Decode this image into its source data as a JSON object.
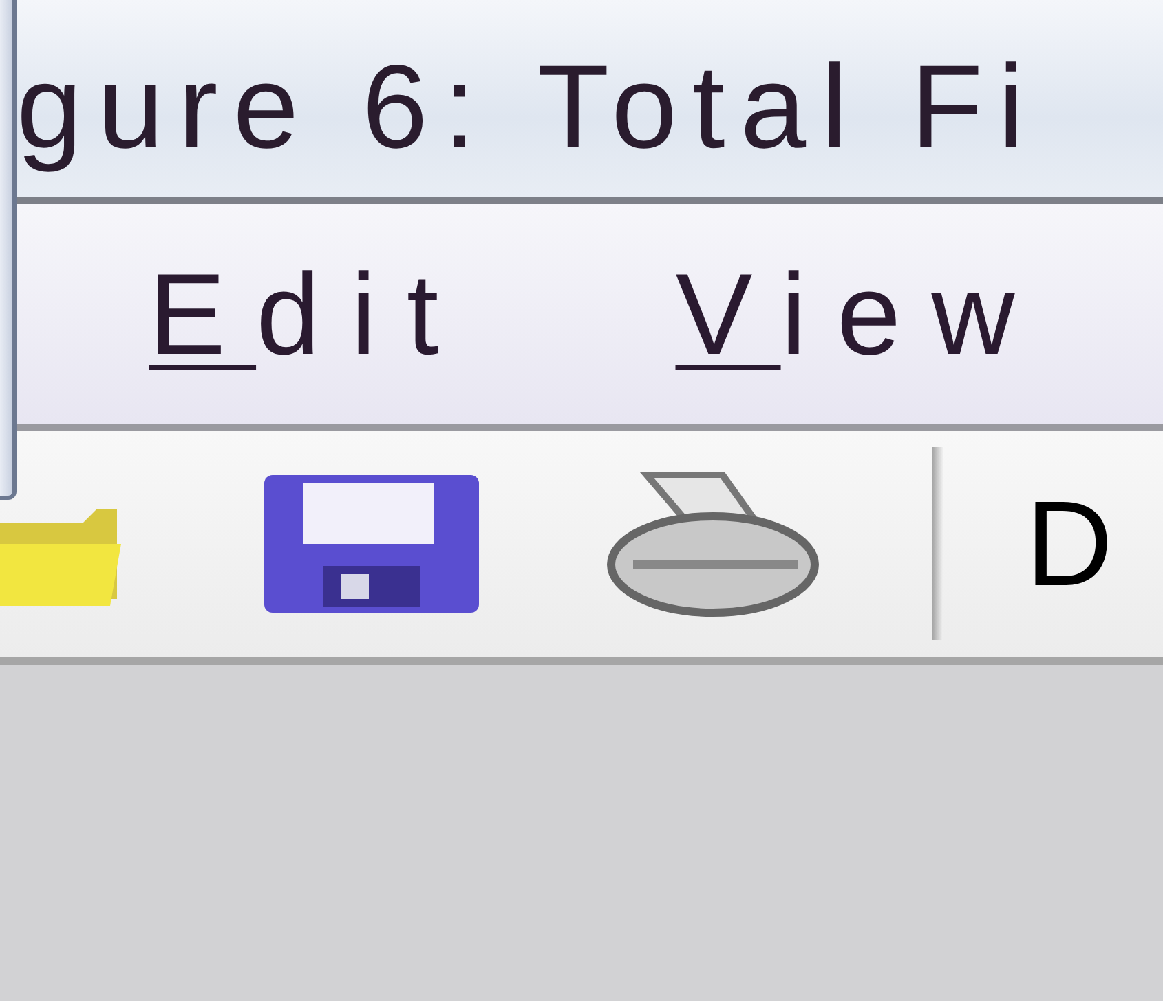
{
  "window": {
    "title": "gure 6: Total Fi"
  },
  "menu": [
    {
      "mnemonic": "E",
      "rest": "dit"
    },
    {
      "mnemonic": "V",
      "rest": "iew"
    }
  ],
  "toolbar": {
    "items": [
      {
        "kind": "folder"
      },
      {
        "kind": "save"
      },
      {
        "kind": "print"
      },
      {
        "kind": "separator"
      },
      {
        "kind": "text",
        "label": "D"
      }
    ]
  }
}
